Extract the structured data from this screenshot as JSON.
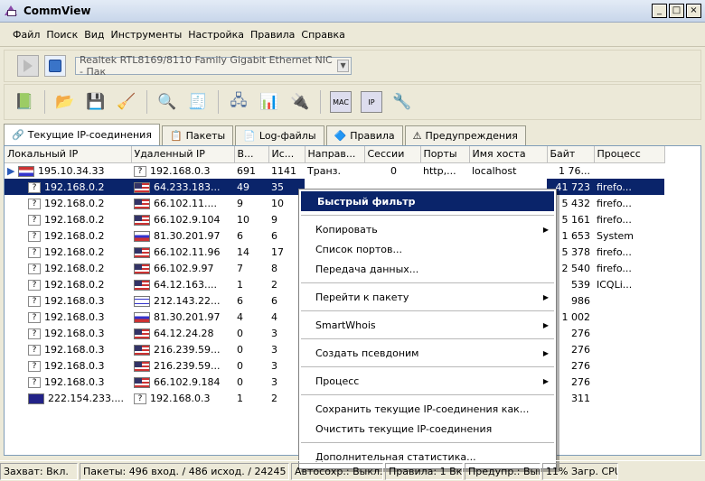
{
  "window": {
    "title": "CommView",
    "min": "_",
    "max": "□",
    "close": "×"
  },
  "menu": [
    "Файл",
    "Поиск",
    "Вид",
    "Инструменты",
    "Настройка",
    "Правила",
    "Справка"
  ],
  "toolbar": {
    "adapter": "Realtek RTL8169/8110 Family Gigabit Ethernet NIC - Пак"
  },
  "tabs": [
    {
      "label": "Текущие IP-соединения",
      "icon": "connections-icon"
    },
    {
      "label": "Пакеты",
      "icon": "packets-icon"
    },
    {
      "label": "Log-файлы",
      "icon": "log-icon"
    },
    {
      "label": "Правила",
      "icon": "rules-icon"
    },
    {
      "label": "Предупреждения",
      "icon": "alerts-icon"
    }
  ],
  "columns": [
    "Локальный IP",
    "Удаленный IP",
    "В...",
    "Ис...",
    "Направ...",
    "Сессии",
    "Порты",
    "Имя хоста",
    "Байт",
    "Процесс"
  ],
  "rows": [
    {
      "local": "195.10.34.33",
      "lflag": "nl",
      "remote": "192.168.0.3",
      "rflag": "q",
      "in": "691",
      "out": "1141",
      "dir": "Транз.",
      "sess": "0",
      "ports": "http,...",
      "host": "localhost",
      "bytes": "1 76...",
      "proc": ""
    },
    {
      "local": "192.168.0.2",
      "lflag": "q",
      "remote": "64.233.183...",
      "rflag": "us",
      "in": "49",
      "out": "35",
      "dir": "",
      "sess": "",
      "ports": "",
      "host": "",
      "bytes": "41 723",
      "proc": "firefo..."
    },
    {
      "local": "192.168.0.2",
      "lflag": "q",
      "remote": "66.102.11....",
      "rflag": "us",
      "in": "9",
      "out": "10",
      "dir": "",
      "sess": "",
      "ports": "",
      "host": "",
      "bytes": "5 432",
      "proc": "firefo..."
    },
    {
      "local": "192.168.0.2",
      "lflag": "q",
      "remote": "66.102.9.104",
      "rflag": "us",
      "in": "10",
      "out": "9",
      "dir": "",
      "sess": "",
      "ports": "",
      "host": "",
      "bytes": "5 161",
      "proc": "firefo..."
    },
    {
      "local": "192.168.0.2",
      "lflag": "q",
      "remote": "81.30.201.97",
      "rflag": "ru",
      "in": "6",
      "out": "6",
      "dir": "",
      "sess": "",
      "ports": "",
      "host": "",
      "bytes": "1 653",
      "proc": "System"
    },
    {
      "local": "192.168.0.2",
      "lflag": "q",
      "remote": "66.102.11.96",
      "rflag": "us",
      "in": "14",
      "out": "17",
      "dir": "",
      "sess": "",
      "ports": "",
      "host": "",
      "bytes": "5 378",
      "proc": "firefo..."
    },
    {
      "local": "192.168.0.2",
      "lflag": "q",
      "remote": "66.102.9.97",
      "rflag": "us",
      "in": "7",
      "out": "8",
      "dir": "",
      "sess": "",
      "ports": "",
      "host": "",
      "bytes": "2 540",
      "proc": "firefo..."
    },
    {
      "local": "192.168.0.2",
      "lflag": "q",
      "remote": "64.12.163....",
      "rflag": "us",
      "in": "1",
      "out": "2",
      "dir": "",
      "sess": "",
      "ports": "",
      "host": "",
      "bytes": "539",
      "proc": "ICQLi..."
    },
    {
      "local": "192.168.0.3",
      "lflag": "q",
      "remote": "212.143.22...",
      "rflag": "il",
      "in": "6",
      "out": "6",
      "dir": "",
      "sess": "",
      "ports": "",
      "host": "",
      "bytes": "986",
      "proc": ""
    },
    {
      "local": "192.168.0.3",
      "lflag": "q",
      "remote": "81.30.201.97",
      "rflag": "ru",
      "in": "4",
      "out": "4",
      "dir": "",
      "sess": "",
      "ports": "",
      "host": "",
      "bytes": "1 002",
      "proc": ""
    },
    {
      "local": "192.168.0.3",
      "lflag": "q",
      "remote": "64.12.24.28",
      "rflag": "us",
      "in": "0",
      "out": "3",
      "dir": "",
      "sess": "",
      "ports": "",
      "host": "",
      "bytes": "276",
      "proc": ""
    },
    {
      "local": "192.168.0.3",
      "lflag": "q",
      "remote": "216.239.59...",
      "rflag": "us",
      "in": "0",
      "out": "3",
      "dir": "",
      "sess": "",
      "ports": "",
      "host": "",
      "bytes": "276",
      "proc": ""
    },
    {
      "local": "192.168.0.3",
      "lflag": "q",
      "remote": "216.239.59...",
      "rflag": "us",
      "in": "0",
      "out": "3",
      "dir": "",
      "sess": "",
      "ports": "",
      "host": "",
      "bytes": "276",
      "proc": ""
    },
    {
      "local": "192.168.0.3",
      "lflag": "q",
      "remote": "66.102.9.184",
      "rflag": "us",
      "in": "0",
      "out": "3",
      "dir": "",
      "sess": "",
      "ports": "",
      "host": "",
      "bytes": "276",
      "proc": ""
    },
    {
      "local": "222.154.233....",
      "lflag": "au",
      "remote": "192.168.0.3",
      "rflag": "q",
      "in": "1",
      "out": "2",
      "dir": "",
      "sess": "",
      "ports": "",
      "host": "",
      "bytes": "311",
      "proc": ""
    }
  ],
  "context_menu": {
    "items": [
      {
        "label": "Быстрый фильтр",
        "bold": true
      },
      {
        "sep": true
      },
      {
        "label": "Копировать",
        "sub": true
      },
      {
        "label": "Список портов..."
      },
      {
        "label": "Передача данных..."
      },
      {
        "sep": true
      },
      {
        "label": "Перейти к пакету",
        "sub": true
      },
      {
        "sep": true
      },
      {
        "label": "SmartWhois",
        "sub": true
      },
      {
        "sep": true
      },
      {
        "label": "Создать псевдоним",
        "sub": true
      },
      {
        "sep": true
      },
      {
        "label": "Процесс",
        "sub": true
      },
      {
        "sep": true
      },
      {
        "label": "Сохранить текущие IP-соединения как..."
      },
      {
        "label": "Очистить текущие IP-соединения"
      },
      {
        "sep": true
      },
      {
        "label": "Дополнительная статистика..."
      }
    ]
  },
  "status": [
    "Захват: Вкл.",
    "Пакеты: 496 вход. / 486 исход. / 24245",
    "Автосохр.: Выкл.",
    "Правила: 1 Вк",
    "Предупр.: Вык",
    "11% Загр. CPU"
  ],
  "status_widths": [
    86,
    232,
    102,
    86,
    84,
    84
  ]
}
